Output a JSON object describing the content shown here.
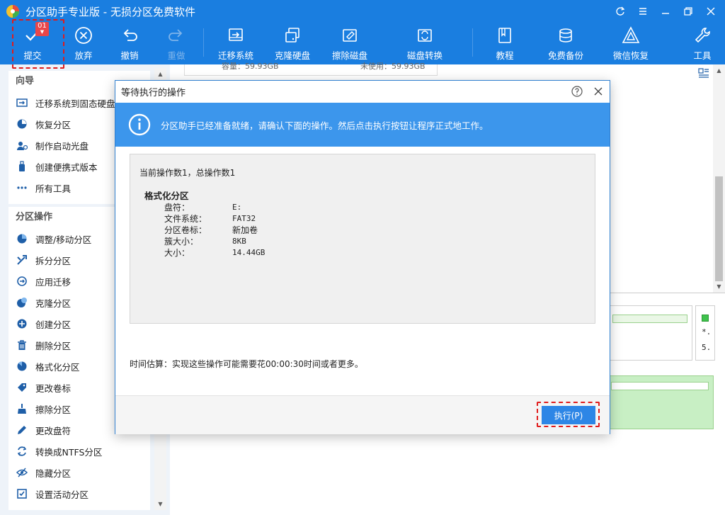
{
  "window": {
    "title": "分区助手专业版 - 无损分区免费软件"
  },
  "toolbar": {
    "badge_count": "01",
    "items": [
      {
        "label": "提交",
        "icon": "check-icon"
      },
      {
        "label": "放弃",
        "icon": "discard-icon"
      },
      {
        "label": "撤销",
        "icon": "undo-icon"
      },
      {
        "label": "重做",
        "icon": "redo-icon"
      },
      {
        "label": "迁移系统",
        "icon": "migrate-os-icon"
      },
      {
        "label": "克隆硬盘",
        "icon": "clone-disk-icon"
      },
      {
        "label": "擦除磁盘",
        "icon": "wipe-disk-icon"
      },
      {
        "label": "磁盘转换",
        "icon": "disk-convert-icon"
      },
      {
        "label": "教程",
        "icon": "book-icon"
      },
      {
        "label": "免费备份",
        "icon": "backup-icon"
      },
      {
        "label": "微信恢复",
        "icon": "recovery-icon"
      },
      {
        "label": "工具",
        "icon": "wrench-icon"
      }
    ]
  },
  "sidebar": {
    "wizard_header": "向导",
    "wizard_items": [
      {
        "label": "迁移系统到固态硬盘",
        "icon": "migrate-ssd-icon"
      },
      {
        "label": "恢复分区",
        "icon": "recover-partition-icon"
      },
      {
        "label": "制作启动光盘",
        "icon": "bootable-media-icon"
      },
      {
        "label": "创建便携式版本",
        "icon": "portable-version-icon"
      },
      {
        "label": "所有工具",
        "icon": "all-tools-icon"
      }
    ],
    "partition_header": "分区操作",
    "partition_items": [
      {
        "label": "调整/移动分区",
        "icon": "resize-icon"
      },
      {
        "label": "拆分分区",
        "icon": "split-icon"
      },
      {
        "label": "应用迁移",
        "icon": "app-mover-icon"
      },
      {
        "label": "克隆分区",
        "icon": "clone-partition-icon"
      },
      {
        "label": "创建分区",
        "icon": "create-partition-icon"
      },
      {
        "label": "删除分区",
        "icon": "delete-icon"
      },
      {
        "label": "格式化分区",
        "icon": "format-icon"
      },
      {
        "label": "更改卷标",
        "icon": "label-tag-icon"
      },
      {
        "label": "擦除分区",
        "icon": "wipe-partition-icon"
      },
      {
        "label": "更改盘符",
        "icon": "drive-letter-icon"
      },
      {
        "label": "转换成NTFS分区",
        "icon": "convert-ntfs-icon"
      },
      {
        "label": "隐藏分区",
        "icon": "hide-icon"
      },
      {
        "label": "设置活动分区",
        "icon": "set-active-icon"
      }
    ]
  },
  "background": {
    "capacity": "容量：59.93GB",
    "unused": "未使用：59.93GB",
    "mini_t1": "*.",
    "mini_t2": "5."
  },
  "dialog": {
    "title": "等待执行的操作",
    "banner": "分区助手已经准备就绪，请确认下面的操作。然后点击执行按钮让程序正式地工作。",
    "op_count": "当前操作数1，总操作数1",
    "op_name": "格式化分区",
    "op_details": [
      {
        "key": "盘符：",
        "value": "E:"
      },
      {
        "key": "文件系统：",
        "value": "FAT32"
      },
      {
        "key": "分区卷标：",
        "value": "新加卷"
      },
      {
        "key": "簇大小：",
        "value": "8KB"
      },
      {
        "key": "大小：",
        "value": "14.44GB"
      }
    ],
    "estimate": "时间估算：实现这些操作可能需要花00:00:30时间或者更多。",
    "execute_button": "执行(P)"
  },
  "colors": {
    "toolbar_bg": "#1a7ee0",
    "banner_bg": "#3c96ec",
    "execute_bg": "#2d86e6",
    "highlight_dash": "#e01b1b",
    "partition_green": "#c8efc4"
  }
}
